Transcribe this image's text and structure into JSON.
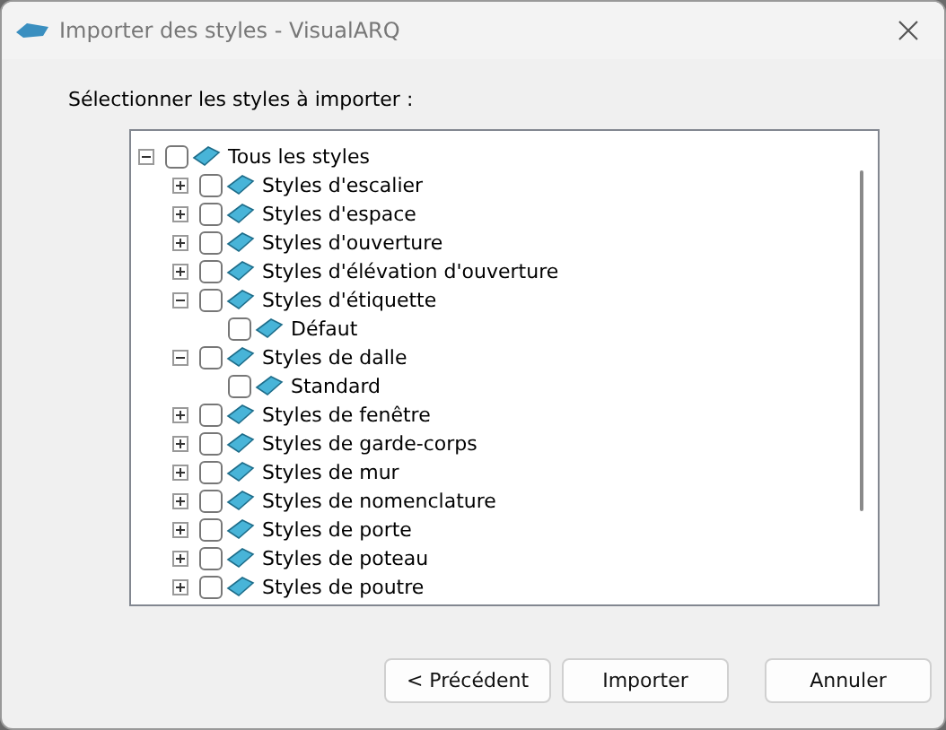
{
  "window": {
    "title": "Importer des styles - VisualARQ"
  },
  "prompt": "Sélectionner les styles à importer :",
  "tree": [
    {
      "label": "Tous les styles",
      "checked": false,
      "expanded": true,
      "children": [
        {
          "label": "Styles d'escalier",
          "checked": false,
          "expanded": false
        },
        {
          "label": "Styles d'espace",
          "checked": false,
          "expanded": false
        },
        {
          "label": "Styles d'ouverture",
          "checked": false,
          "expanded": false
        },
        {
          "label": "Styles d'élévation d'ouverture",
          "checked": false,
          "expanded": false
        },
        {
          "label": "Styles d'étiquette",
          "checked": false,
          "expanded": true,
          "children": [
            {
              "label": "Défaut",
              "checked": false
            }
          ]
        },
        {
          "label": "Styles de dalle",
          "checked": false,
          "expanded": true,
          "children": [
            {
              "label": "Standard",
              "checked": false
            }
          ]
        },
        {
          "label": "Styles de fenêtre",
          "checked": false,
          "expanded": false
        },
        {
          "label": "Styles de garde-corps",
          "checked": false,
          "expanded": false
        },
        {
          "label": "Styles de mur",
          "checked": false,
          "expanded": false
        },
        {
          "label": "Styles de nomenclature",
          "checked": false,
          "expanded": false
        },
        {
          "label": "Styles de porte",
          "checked": false,
          "expanded": false
        },
        {
          "label": "Styles de poteau",
          "checked": false,
          "expanded": false
        },
        {
          "label": "Styles de poutre",
          "checked": false,
          "expanded": false
        }
      ]
    }
  ],
  "buttons": [
    "< Précédent",
    "Importer",
    "Annuler"
  ]
}
